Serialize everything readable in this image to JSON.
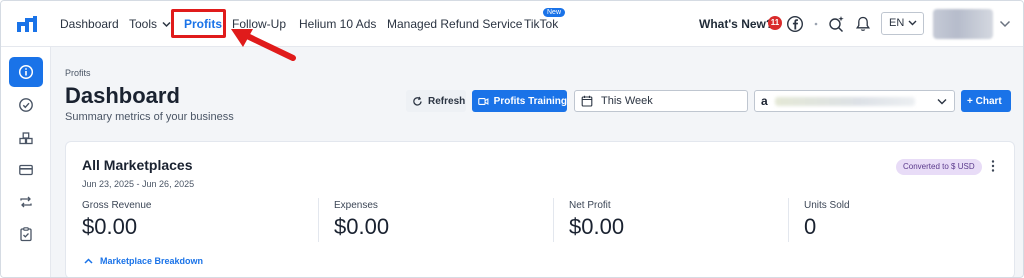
{
  "nav": {
    "items": [
      {
        "label": "Dashboard"
      },
      {
        "label": "Tools"
      },
      {
        "label": "Profits"
      },
      {
        "label": "Follow-Up"
      },
      {
        "label": "Helium 10 Ads"
      },
      {
        "label": "Managed Refund Service"
      },
      {
        "label": "TikTok"
      }
    ],
    "new_badge": "New",
    "whats_new": "What's New?",
    "notification_count": "11",
    "language": "EN",
    "icons": [
      "facebook-icon",
      "sparkle-search-icon",
      "bell-icon"
    ]
  },
  "sidebar": {
    "items": [
      "info-icon",
      "gauge-icon",
      "boxes-icon",
      "card-icon",
      "repeat-icon",
      "clipboard-icon"
    ],
    "active": "info-icon"
  },
  "page": {
    "breadcrumb": "Profits",
    "title": "Dashboard",
    "subtitle": "Summary metrics of your business"
  },
  "toolbar": {
    "refresh_label": "Refresh",
    "training_label": "Profits Training",
    "date_range": "This Week",
    "marketplace_prefix": "a",
    "chart_label": "+ Chart"
  },
  "card": {
    "title": "All Marketplaces",
    "dates": "Jun 23, 2025 - Jun 26, 2025",
    "currency_badge": "Converted to $ USD",
    "metrics": [
      {
        "label": "Gross Revenue",
        "value": "$0.00"
      },
      {
        "label": "Expenses",
        "value": "$0.00"
      },
      {
        "label": "Net Profit",
        "value": "$0.00"
      },
      {
        "label": "Units Sold",
        "value": "0"
      }
    ],
    "breakdown_label": "Marketplace Breakdown"
  },
  "colors": {
    "accent": "#1a73e8",
    "highlight": "#e01b1b",
    "badge_purple": "#e8dcf7"
  }
}
